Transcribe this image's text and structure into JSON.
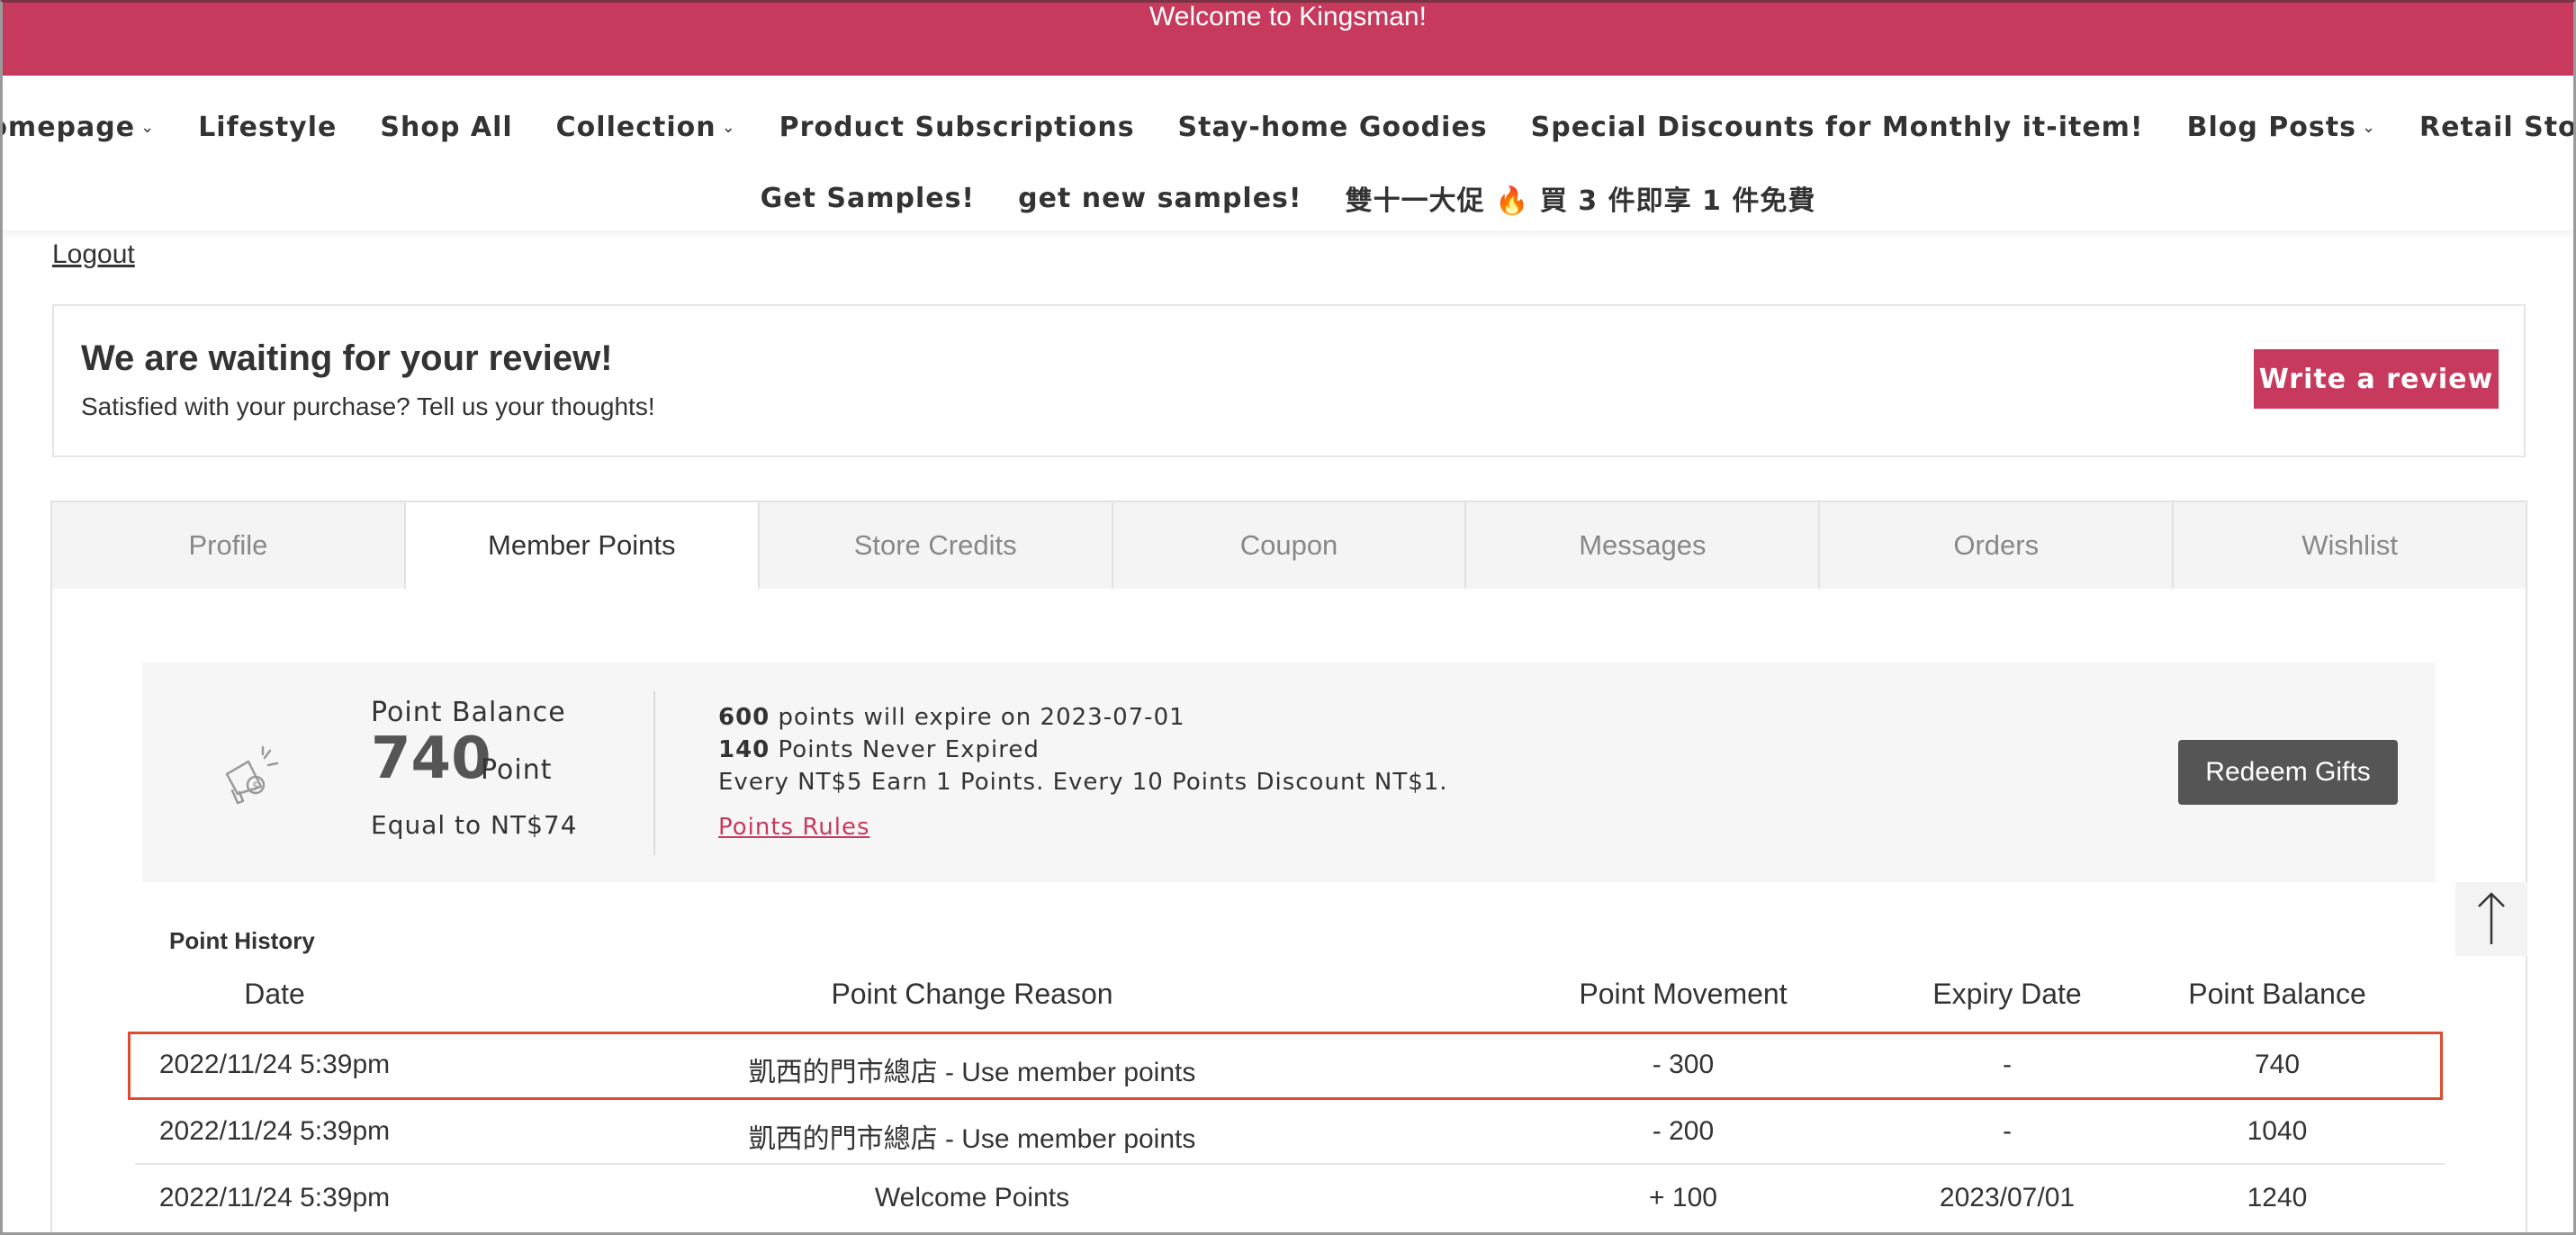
{
  "announcement": "Welcome to Kingsman!",
  "nav": {
    "row1": [
      {
        "label": "Homepage",
        "dropdown": true
      },
      {
        "label": "Lifestyle",
        "dropdown": false
      },
      {
        "label": "Shop All",
        "dropdown": false
      },
      {
        "label": "Collection",
        "dropdown": true
      },
      {
        "label": "Product Subscriptions",
        "dropdown": false
      },
      {
        "label": "Stay-home Goodies",
        "dropdown": false
      },
      {
        "label": "Special Discounts for Monthly it-item!",
        "dropdown": false
      },
      {
        "label": "Blog Posts",
        "dropdown": true
      },
      {
        "label": "Retail Store",
        "dropdown": false
      }
    ],
    "row2": [
      {
        "label": "Get Samples!"
      },
      {
        "label": "get new samples!"
      },
      {
        "label": "雙十一大促 🔥 買 3 件即享 1 件免費"
      }
    ]
  },
  "logout": "Logout",
  "review": {
    "title": "We are waiting for your review!",
    "subtitle": "Satisfied with your purchase? Tell us your thoughts!",
    "button": "Write a review"
  },
  "tabs": [
    {
      "label": "Profile",
      "active": false
    },
    {
      "label": "Member Points",
      "active": true
    },
    {
      "label": "Store Credits",
      "active": false
    },
    {
      "label": "Coupon",
      "active": false
    },
    {
      "label": "Messages",
      "active": false
    },
    {
      "label": "Orders",
      "active": false
    },
    {
      "label": "Wishlist",
      "active": false
    }
  ],
  "points": {
    "balance_label": "Point Balance",
    "balance_value": "740",
    "unit": "Point",
    "equal": "Equal to NT$74",
    "expire_count": "600",
    "expire_text": " points will expire on 2023-07-01",
    "never_count": "140",
    "never_text": " Points Never Expired",
    "earn_text": "Every NT$5 Earn 1 Points. Every 10 Points Discount NT$1.",
    "rules_link": "Points Rules",
    "redeem_button": "Redeem Gifts",
    "icon": "megaphone-icon"
  },
  "history": {
    "title": "Point History",
    "headers": [
      "Date",
      "Point Change Reason",
      "Point Movement",
      "Expiry Date",
      "Point Balance"
    ],
    "rows": [
      {
        "date": "2022/11/24 5:39pm",
        "reason": "凱西的門市總店 - Use member points",
        "movement": "- 300",
        "expiry": "-",
        "balance": "740"
      },
      {
        "date": "2022/11/24 5:39pm",
        "reason": "凱西的門市總店 - Use member points",
        "movement": "- 200",
        "expiry": "-",
        "balance": "1040"
      },
      {
        "date": "2022/11/24 5:39pm",
        "reason": "Welcome Points",
        "movement": "+ 100",
        "expiry": "2023/07/01",
        "balance": "1240"
      }
    ]
  },
  "colors": {
    "brand": "#c83a5d",
    "highlight": "#e04a2f",
    "button_dark": "#555555"
  }
}
